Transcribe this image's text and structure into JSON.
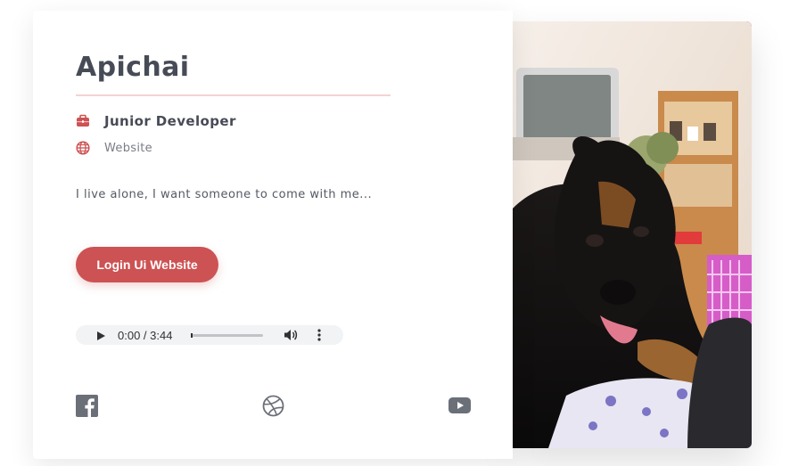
{
  "profile": {
    "name": "Apichai",
    "job_title": "Junior Developer",
    "website_label": "Website",
    "bio": "I live alone, I want someone to come with me...",
    "login_button_label": "Login Ui Website"
  },
  "audio": {
    "time_display": "0:00 / 3:44",
    "progress": 0
  },
  "icons": {
    "job": "briefcase-icon",
    "website": "globe-icon",
    "social": [
      "facebook-icon",
      "dribbble-icon",
      "youtube-icon"
    ]
  },
  "colors": {
    "accent": "#cd5253",
    "underline": "#f3d3d3",
    "icon_gray": "#6b6f78",
    "text_dark": "#474b56"
  }
}
